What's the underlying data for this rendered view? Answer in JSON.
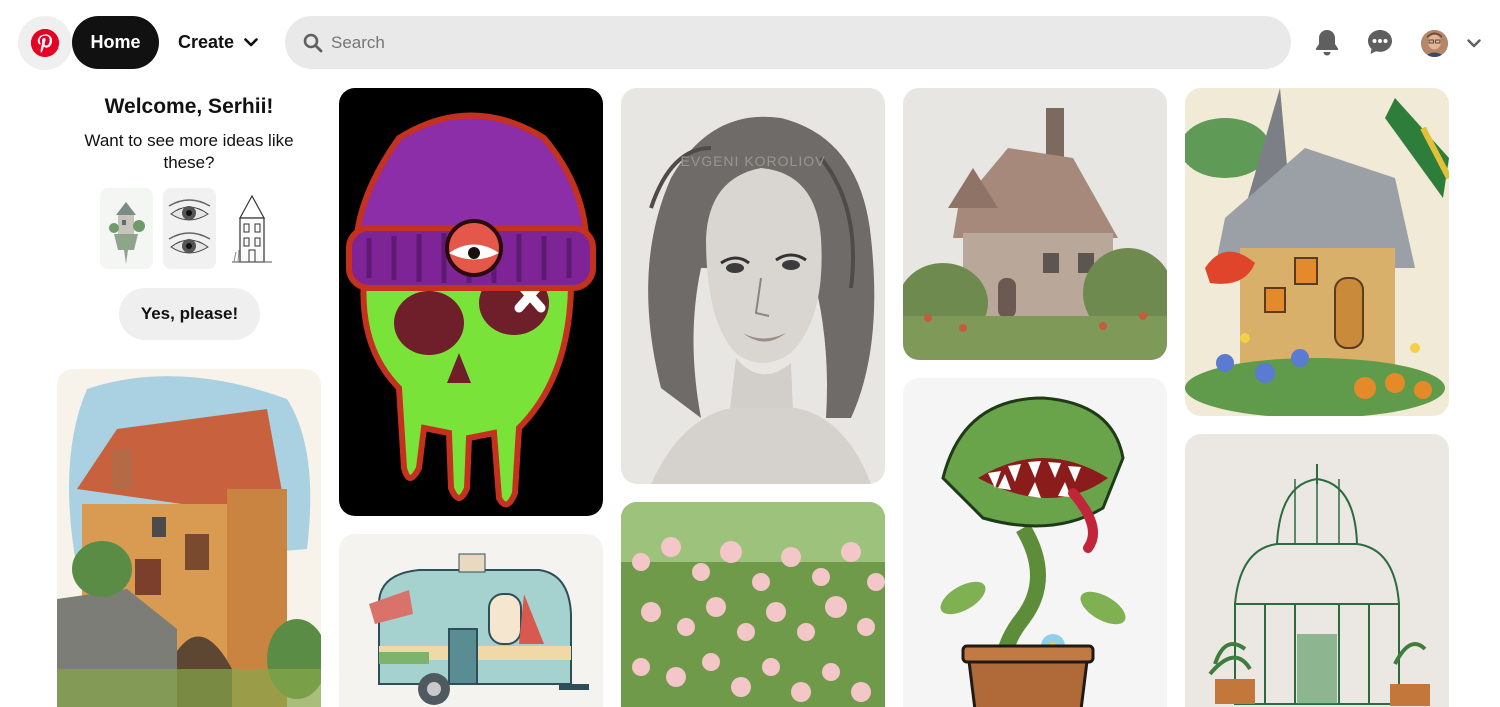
{
  "header": {
    "home_label": "Home",
    "create_label": "Create",
    "search_placeholder": "Search",
    "icons": [
      "pinterest-logo",
      "chevron-down-icon",
      "search-icon",
      "bell-icon",
      "chat-icon",
      "avatar",
      "chevron-down-icon"
    ]
  },
  "welcome": {
    "title": "Welcome, Serhii!",
    "subtitle": "Want to see more ideas like these?",
    "button_label": "Yes, please!"
  },
  "pins": {
    "portrait_watermark": "EVGENI KOROLIOV"
  },
  "colors": {
    "brand": "#e60023",
    "home_button_bg": "#111111",
    "search_bg": "#e9e9e9",
    "secondary_button_bg": "#efefef"
  }
}
